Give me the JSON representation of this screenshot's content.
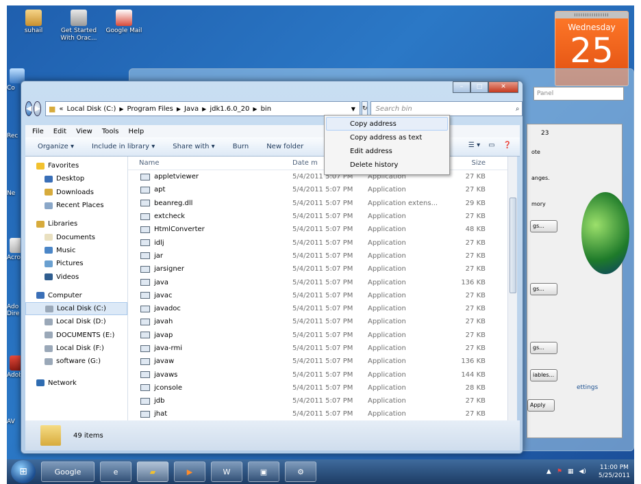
{
  "desktop": {
    "icons": [
      {
        "label": "suhail"
      },
      {
        "label": "Get Started With Orac..."
      },
      {
        "label": "Google Mail"
      }
    ],
    "side_labels": [
      "Co",
      "Rec",
      "Ne",
      "Acro",
      "Ado Dire",
      "Adob",
      "AV"
    ]
  },
  "calendar": {
    "day": "Wednesday",
    "date": "25"
  },
  "background_window": {
    "search_placeholder": "Panel",
    "buttons": [
      "gs...",
      "gs...",
      "gs...",
      "iables...",
      "Apply"
    ],
    "texts": [
      "anges.",
      "mory",
      "ettings",
      "ote",
      "23"
    ]
  },
  "explorer": {
    "title_buttons": {
      "min": "–",
      "max": "□",
      "close": "✕"
    },
    "address": {
      "crumbs": [
        "Local Disk (C:)",
        "Program Files",
        "Java",
        "jdk1.6.0_20",
        "bin"
      ],
      "prefix": "«"
    },
    "search_placeholder": "Search bin",
    "menu": [
      "File",
      "Edit",
      "View",
      "Tools",
      "Help"
    ],
    "toolbar": [
      "Organize ▾",
      "Include in library ▾",
      "Share with ▾",
      "Burn",
      "New folder"
    ],
    "nav": {
      "favorites": "Favorites",
      "favorites_items": [
        "Desktop",
        "Downloads",
        "Recent Places"
      ],
      "libraries": "Libraries",
      "libraries_items": [
        "Documents",
        "Music",
        "Pictures",
        "Videos"
      ],
      "computer": "Computer",
      "computer_items": [
        "Local Disk (C:)",
        "Local Disk (D:)",
        "DOCUMENTS (E:)",
        "Local Disk (F:)",
        "software (G:)"
      ],
      "network": "Network"
    },
    "columns": {
      "name": "Name",
      "date": "Date m",
      "type": "",
      "size": "Size"
    },
    "files": [
      {
        "name": "appletviewer",
        "date": "5/4/2011 5:07 PM",
        "type": "Application",
        "size": "27 KB"
      },
      {
        "name": "apt",
        "date": "5/4/2011 5:07 PM",
        "type": "Application",
        "size": "27 KB"
      },
      {
        "name": "beanreg.dll",
        "date": "5/4/2011 5:07 PM",
        "type": "Application extens...",
        "size": "29 KB"
      },
      {
        "name": "extcheck",
        "date": "5/4/2011 5:07 PM",
        "type": "Application",
        "size": "27 KB"
      },
      {
        "name": "HtmlConverter",
        "date": "5/4/2011 5:07 PM",
        "type": "Application",
        "size": "48 KB"
      },
      {
        "name": "idlj",
        "date": "5/4/2011 5:07 PM",
        "type": "Application",
        "size": "27 KB"
      },
      {
        "name": "jar",
        "date": "5/4/2011 5:07 PM",
        "type": "Application",
        "size": "27 KB"
      },
      {
        "name": "jarsigner",
        "date": "5/4/2011 5:07 PM",
        "type": "Application",
        "size": "27 KB"
      },
      {
        "name": "java",
        "date": "5/4/2011 5:07 PM",
        "type": "Application",
        "size": "136 KB"
      },
      {
        "name": "javac",
        "date": "5/4/2011 5:07 PM",
        "type": "Application",
        "size": "27 KB"
      },
      {
        "name": "javadoc",
        "date": "5/4/2011 5:07 PM",
        "type": "Application",
        "size": "27 KB"
      },
      {
        "name": "javah",
        "date": "5/4/2011 5:07 PM",
        "type": "Application",
        "size": "27 KB"
      },
      {
        "name": "javap",
        "date": "5/4/2011 5:07 PM",
        "type": "Application",
        "size": "27 KB"
      },
      {
        "name": "java-rmi",
        "date": "5/4/2011 5:07 PM",
        "type": "Application",
        "size": "27 KB"
      },
      {
        "name": "javaw",
        "date": "5/4/2011 5:07 PM",
        "type": "Application",
        "size": "136 KB"
      },
      {
        "name": "javaws",
        "date": "5/4/2011 5:07 PM",
        "type": "Application",
        "size": "144 KB"
      },
      {
        "name": "jconsole",
        "date": "5/4/2011 5:07 PM",
        "type": "Application",
        "size": "28 KB"
      },
      {
        "name": "jdb",
        "date": "5/4/2011 5:07 PM",
        "type": "Application",
        "size": "27 KB"
      },
      {
        "name": "jhat",
        "date": "5/4/2011 5:07 PM",
        "type": "Application",
        "size": "27 KB"
      }
    ],
    "status": "49 items"
  },
  "context_menu": {
    "items": [
      "Copy address",
      "Copy address as text",
      "Edit address",
      "Delete history"
    ]
  },
  "taskbar": {
    "google_label": "Google",
    "clock_time": "11:00 PM",
    "clock_date": "5/25/2011"
  },
  "colors": {
    "accent": "#2b78c6",
    "calendar": "#e04e10"
  }
}
